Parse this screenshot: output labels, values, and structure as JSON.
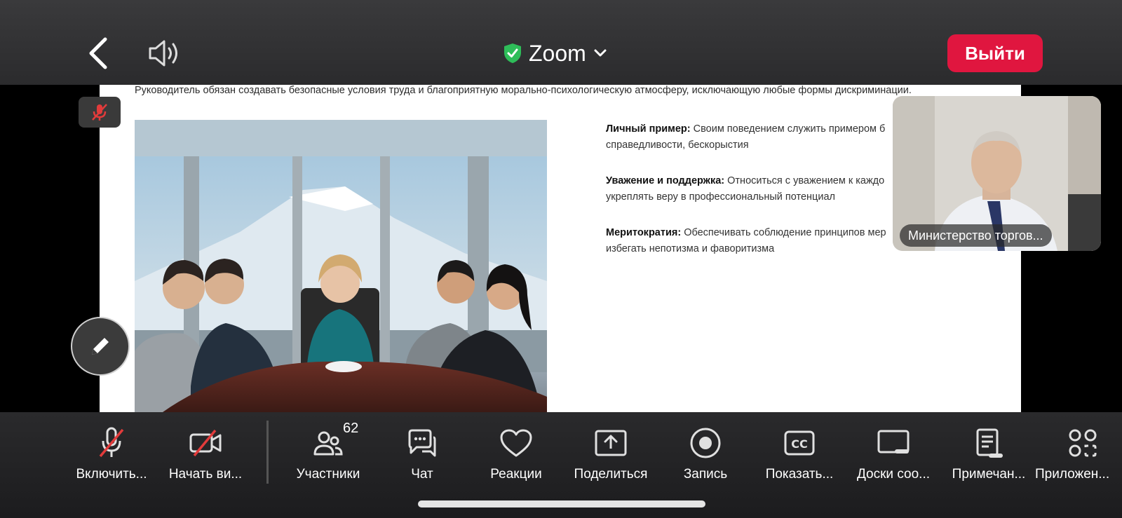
{
  "header": {
    "app_title": "Zoom",
    "leave_label": "Выйти",
    "colors": {
      "leave": "#e0163f",
      "secure": "#2ebd59"
    }
  },
  "slide": {
    "header_text": "Руководитель обязан создавать безопасные условия труда и благоприятную морально-психологическую атмосферу, исключающую любые формы дискриминации.",
    "bullets": [
      {
        "title": "Личный пример:",
        "text": " Своим поведением служить примером б",
        "line2": "справедливости, бескорыстия"
      },
      {
        "title": "Уважение и поддержка:",
        "text": " Относиться с уважением к каждо",
        "line2": "укреплять веру в профессиональный потенциал"
      },
      {
        "title": "Меритократия:",
        "text": " Обеспечивать соблюдение принципов мер",
        "line2": "избегать непотизма и фаворитизма"
      }
    ]
  },
  "participant_thumb": {
    "name": "Министерство торгов..."
  },
  "toolbar": {
    "items": [
      {
        "label": "Включить...",
        "icon": "mic-off-icon"
      },
      {
        "label": "Начать ви...",
        "icon": "video-off-icon"
      },
      {
        "label": "Участники",
        "icon": "participants-icon",
        "badge": "62"
      },
      {
        "label": "Чат",
        "icon": "chat-icon"
      },
      {
        "label": "Реакции",
        "icon": "heart-icon"
      },
      {
        "label": "Поделиться",
        "icon": "share-icon"
      },
      {
        "label": "Запись",
        "icon": "record-icon"
      },
      {
        "label": "Показать...",
        "icon": "cc-icon"
      },
      {
        "label": "Доски соо...",
        "icon": "whiteboard-icon"
      },
      {
        "label": "Примечан...",
        "icon": "notes-icon"
      },
      {
        "label": "Приложен...",
        "icon": "apps-icon"
      }
    ]
  }
}
